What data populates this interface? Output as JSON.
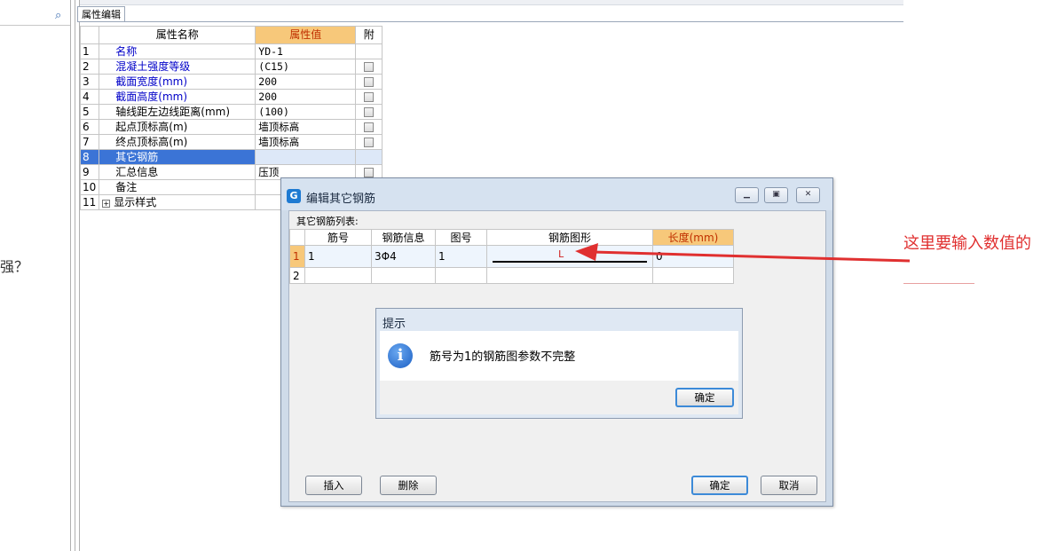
{
  "left": {
    "partial_text": "强？"
  },
  "panel": {
    "tab_label": "属性编辑"
  },
  "property_grid": {
    "headers": {
      "name": "属性名称",
      "value": "属性值",
      "attach": "附"
    },
    "rows": [
      {
        "idx": "1",
        "name": "名称",
        "value": "YD-1",
        "blue": true,
        "checkbox": false
      },
      {
        "idx": "2",
        "name": "混凝土强度等级",
        "value": "(C15)",
        "blue": true,
        "checkbox": true
      },
      {
        "idx": "3",
        "name": "截面宽度(mm)",
        "value": "200",
        "blue": true,
        "checkbox": true
      },
      {
        "idx": "4",
        "name": "截面高度(mm)",
        "value": "200",
        "blue": true,
        "checkbox": true
      },
      {
        "idx": "5",
        "name": "轴线距左边线距离(mm)",
        "value": "(100)",
        "blue": false,
        "checkbox": true
      },
      {
        "idx": "6",
        "name": "起点顶标高(m)",
        "value": "墙顶标高",
        "blue": false,
        "checkbox": true
      },
      {
        "idx": "7",
        "name": "终点顶标高(m)",
        "value": "墙顶标高",
        "blue": false,
        "checkbox": true
      },
      {
        "idx": "8",
        "name": "其它钢筋",
        "value": "",
        "blue": false,
        "checkbox": false,
        "selected": true
      },
      {
        "idx": "9",
        "name": "汇总信息",
        "value": "压顶",
        "blue": false,
        "checkbox": true
      },
      {
        "idx": "10",
        "name": "备注",
        "value": "",
        "blue": false,
        "checkbox": false
      },
      {
        "idx": "11",
        "name": "显示样式",
        "value": "",
        "blue": false,
        "checkbox": false,
        "expander": "+"
      }
    ]
  },
  "rebar_dialog": {
    "title": "编辑其它钢筋",
    "list_label": "其它钢筋列表:",
    "columns": [
      "筋号",
      "钢筋信息",
      "图号",
      "钢筋图形",
      "长度(mm)"
    ],
    "rows": [
      {
        "idx": "1",
        "bar_no": "1",
        "info": "3Φ4",
        "fig_no": "1",
        "shape_label": "L",
        "length": "0"
      },
      {
        "idx": "2",
        "bar_no": "",
        "info": "",
        "fig_no": "",
        "shape_label": "",
        "length": ""
      }
    ],
    "buttons": {
      "insert": "插入",
      "delete": "删除",
      "ok": "确定",
      "cancel": "取消"
    }
  },
  "tip_dialog": {
    "title": "提示",
    "message": "筋号为1的钢筋图参数不完整",
    "ok": "确定"
  },
  "annotation": {
    "text": "这里要输入数值的",
    "color": "#e03030"
  },
  "colors": {
    "header_accent": "#f7c87a",
    "selection": "#3b74d6",
    "dialog_frame": "#cfdbe9"
  }
}
